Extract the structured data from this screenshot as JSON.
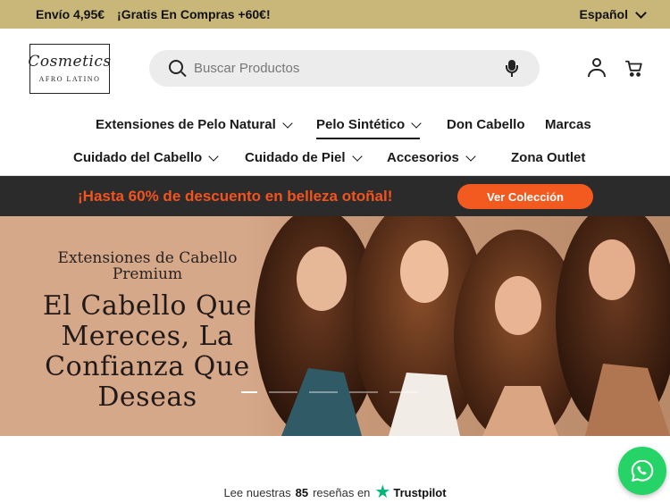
{
  "topbar": {
    "shipping_text": "Envío 4,95€",
    "free_text": "¡Gratis En Compras +60€!",
    "language": "Español"
  },
  "header": {
    "logo_script": "Cosmetics",
    "logo_sub": "AFRO LATINO",
    "search_placeholder": "Buscar Productos",
    "icons": [
      "search-icon",
      "microphone-icon",
      "account-icon",
      "cart-icon"
    ]
  },
  "nav": {
    "row1": [
      {
        "label": "Extensiones de Pelo Natural",
        "dropdown": true
      },
      {
        "label": "Pelo Sintético",
        "dropdown": true
      },
      {
        "label": "Don Cabello",
        "dropdown": false
      },
      {
        "label": "Marcas",
        "dropdown": false
      }
    ],
    "row2": [
      {
        "label": "Cuidado del Cabello",
        "dropdown": true
      },
      {
        "label": "Cuidado de Piel",
        "dropdown": true
      },
      {
        "label": "Accesorios",
        "dropdown": true
      },
      {
        "label": "Zona Outlet",
        "dropdown": false
      }
    ]
  },
  "promo": {
    "message": "¡Hasta 60% de descuento en belleza otoñal!",
    "button": "Ver Colección",
    "colors": {
      "text": "#f2531f",
      "button": "#f25a1f",
      "background": "#2b2b2b"
    }
  },
  "hero": {
    "eyebrow": "Extensiones de Cabello Premium",
    "headline": "El Cabello Que Mereces, La Confianza Que Deseas",
    "slides_count": 5,
    "active_slide": 1
  },
  "reviews": {
    "prefix": "Lee nuestras",
    "count": "85",
    "middle": "reseñas en",
    "brand": "Trustpilot"
  },
  "floating": {
    "whatsapp_icon": "whatsapp-icon"
  },
  "colors": {
    "topbar": "#c9b77a",
    "hero_bg": "#d6a88a",
    "whatsapp": "#25d366"
  }
}
